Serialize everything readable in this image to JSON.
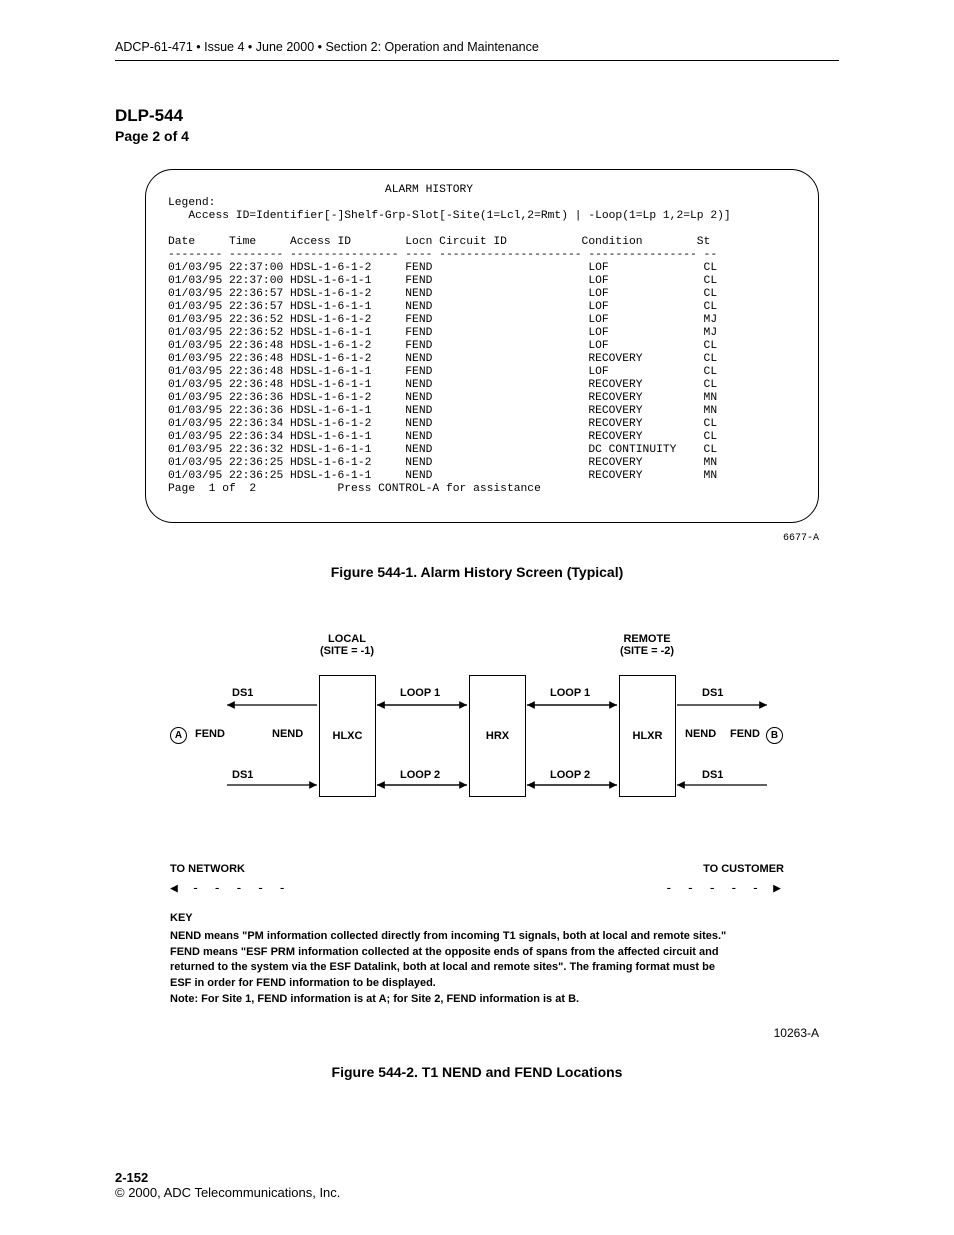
{
  "header": {
    "doc_line": "ADCP-61-471 • Issue 4 • June 2000 • Section 2: Operation and Maintenance"
  },
  "title": {
    "dlp": "DLP-544",
    "page": "Page 2 of 4"
  },
  "terminal": {
    "title_line": "                                ALARM HISTORY",
    "legend_label": "Legend:",
    "legend_line": "   Access ID=Identifier[-]Shelf-Grp-Slot[-Site(1=Lcl,2=Rmt) | -Loop(1=Lp 1,2=Lp 2)]",
    "hdr_line": "Date     Time     Access ID        Locn Circuit ID           Condition        St",
    "dash_line": "-------- -------- ---------------- ---- --------------------- ---------------- --",
    "rows": [
      "01/03/95 22:37:00 HDSL-1-6-1-2     FEND                       LOF              CL",
      "01/03/95 22:37:00 HDSL-1-6-1-1     FEND                       LOF              CL",
      "01/03/95 22:36:57 HDSL-1-6-1-2     NEND                       LOF              CL",
      "01/03/95 22:36:57 HDSL-1-6-1-1     NEND                       LOF              CL",
      "01/03/95 22:36:52 HDSL-1-6-1-2     FEND                       LOF              MJ",
      "01/03/95 22:36:52 HDSL-1-6-1-1     FEND                       LOF              MJ",
      "01/03/95 22:36:48 HDSL-1-6-1-2     FEND                       LOF              CL",
      "01/03/95 22:36:48 HDSL-1-6-1-2     NEND                       RECOVERY         CL",
      "01/03/95 22:36:48 HDSL-1-6-1-1     FEND                       LOF              CL",
      "01/03/95 22:36:48 HDSL-1-6-1-1     NEND                       RECOVERY         CL",
      "01/03/95 22:36:36 HDSL-1-6-1-2     NEND                       RECOVERY         MN",
      "01/03/95 22:36:36 HDSL-1-6-1-1     NEND                       RECOVERY         MN",
      "01/03/95 22:36:34 HDSL-1-6-1-2     NEND                       RECOVERY         CL",
      "01/03/95 22:36:34 HDSL-1-6-1-1     NEND                       RECOVERY         CL",
      "01/03/95 22:36:32 HDSL-1-6-1-1     NEND                       DC CONTINUITY    CL",
      "01/03/95 22:36:25 HDSL-1-6-1-2     NEND                       RECOVERY         MN",
      "01/03/95 22:36:25 HDSL-1-6-1-1     NEND                       RECOVERY         MN"
    ],
    "footer_line": "Page  1 of  2            Press CONTROL-A for assistance"
  },
  "fig1": {
    "id": "6677-A",
    "caption": "Figure 544-1. Alarm History Screen (Typical)"
  },
  "diagram": {
    "local_top": "LOCAL",
    "local_sub": "(SITE = -1)",
    "remote_top": "REMOTE",
    "remote_sub": "(SITE = -2)",
    "ds1": "DS1",
    "loop1": "LOOP 1",
    "loop2": "LOOP 2",
    "A": "A",
    "B": "B",
    "fend": "FEND",
    "nend": "NEND",
    "hlxc": "HLXC",
    "hrx": "HRX",
    "hlxr": "HLXR"
  },
  "netcust": {
    "net": "TO NETWORK",
    "cust": "TO CUSTOMER"
  },
  "key": {
    "title": "KEY",
    "line1": "NEND means \"PM information collected directly from incoming T1 signals, both at local and remote sites.\"",
    "line2": "FEND means \"ESF PRM information collected at the opposite ends of spans from the affected circuit and",
    "line3": "returned to the system via the ESF Datalink, both at local and remote sites\". The framing format must be",
    "line4": "ESF in order for FEND information to be displayed.",
    "note": "Note: For Site 1, FEND information is at A; for Site 2, FEND information is at B."
  },
  "fig2": {
    "id": "10263-A",
    "caption": "Figure 544-2. T1 NEND and FEND Locations"
  },
  "footer": {
    "pagenum": "2-152",
    "copyright": "© 2000, ADC Telecommunications, Inc."
  }
}
